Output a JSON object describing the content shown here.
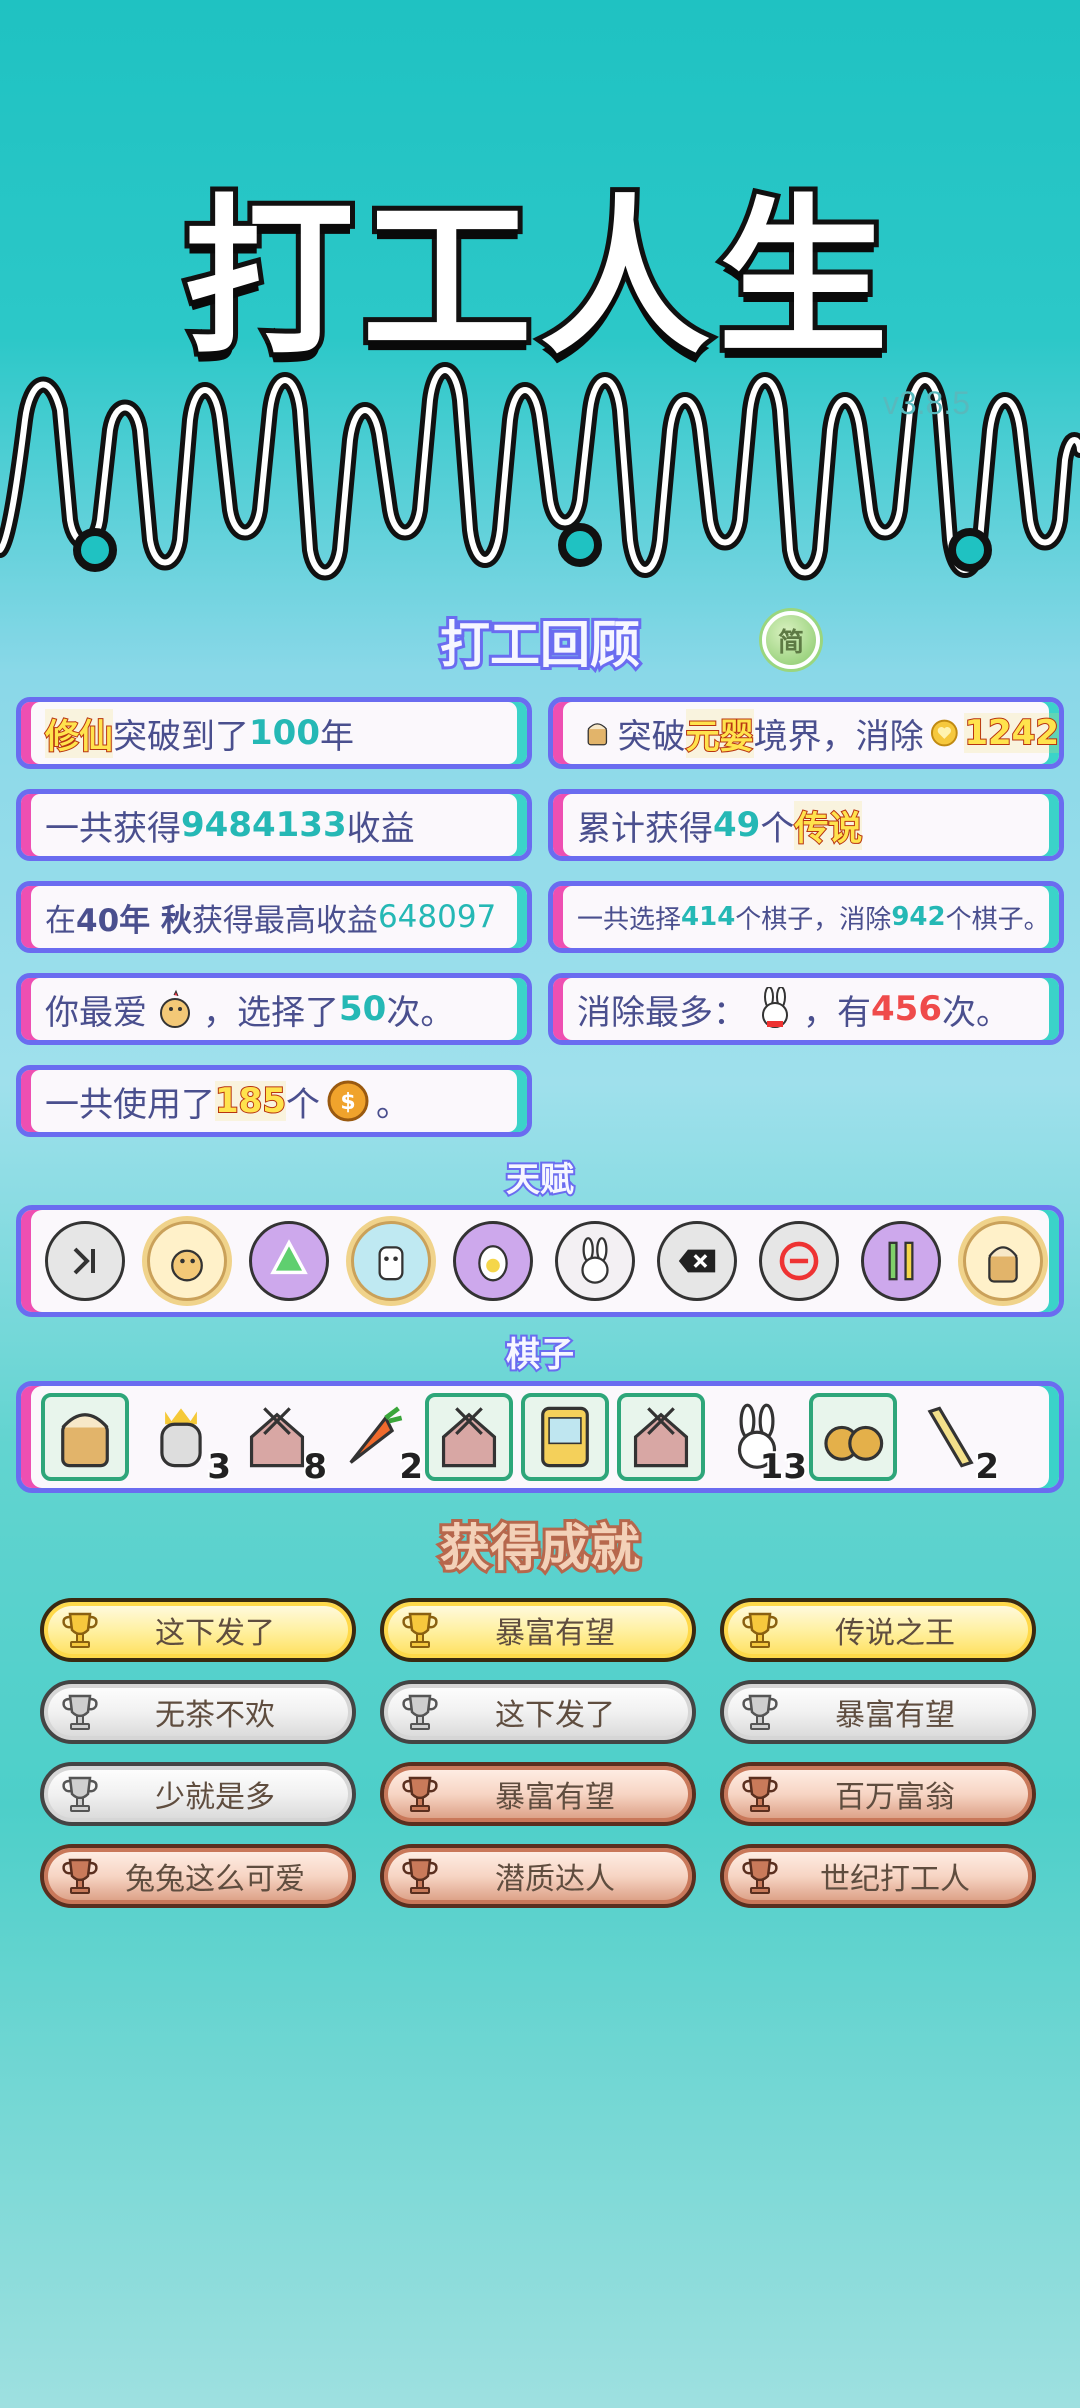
{
  "app": {
    "title": "打工人生",
    "version": "v3.8.5"
  },
  "review": {
    "title": "打工回顾",
    "lang_badge": "简",
    "cards": {
      "c1": {
        "a": "修仙",
        "b": "突破到了",
        "c": "100",
        "d": "年"
      },
      "c2": {
        "a": "突破",
        "b": "元婴",
        "c": "境界，消除",
        "d": "1242"
      },
      "c3": {
        "a": "一共获得",
        "b": "9484133",
        "c": "收益"
      },
      "c4": {
        "a": "累计获得",
        "b": "49",
        "c": "个",
        "d": "传说"
      },
      "c5": {
        "a": "在 ",
        "b": "40年 秋",
        "c": " 获得最高收益",
        "d": "648097"
      },
      "c6": {
        "a": "一共选择",
        "b": "414",
        "c": "个棋子，消除",
        "d": "942",
        "e": "个棋子。"
      },
      "c7": {
        "a": "你最爱",
        "b": "，选择了",
        "c": "50",
        "d": "次。"
      },
      "c8": {
        "a": "消除最多：",
        "b": "，有",
        "c": "456",
        "d": "次。"
      },
      "c9": {
        "a": "一共使用了",
        "b": "185",
        "c": "个",
        "d": "。"
      }
    }
  },
  "talents": {
    "title": "天赋",
    "icons": [
      "skip-icon",
      "chick-icon",
      "recycle-icon",
      "husky-icon",
      "egg-icon",
      "rabbit-icon",
      "delete-tag-icon",
      "minus-icon",
      "bamboo-icon",
      "milk-tea-icon"
    ]
  },
  "pieces": {
    "title": "棋子",
    "items": [
      {
        "icon": "milk-tea-icon",
        "count": ""
      },
      {
        "icon": "crowned-husky-icon",
        "count": "3"
      },
      {
        "icon": "rabbit-house-icon",
        "count": "8"
      },
      {
        "icon": "carrot-icon",
        "count": "2"
      },
      {
        "icon": "rabbit-house-icon",
        "count": ""
      },
      {
        "icon": "claw-machine-icon",
        "count": ""
      },
      {
        "icon": "rabbit-house-icon",
        "count": ""
      },
      {
        "icon": "rabbit-icon",
        "count": "13"
      },
      {
        "icon": "sesame-balls-icon",
        "count": ""
      },
      {
        "icon": "pencil-icon",
        "count": "2"
      }
    ]
  },
  "achievements": {
    "title": "获得成就",
    "items": [
      {
        "label": "这下发了",
        "tier": "gold"
      },
      {
        "label": "暴富有望",
        "tier": "gold"
      },
      {
        "label": "传说之王",
        "tier": "gold"
      },
      {
        "label": "无茶不欢",
        "tier": "silver"
      },
      {
        "label": "这下发了",
        "tier": "silver"
      },
      {
        "label": "暴富有望",
        "tier": "silver"
      },
      {
        "label": "少就是多",
        "tier": "silver"
      },
      {
        "label": "暴富有望",
        "tier": "bronze"
      },
      {
        "label": "百万富翁",
        "tier": "bronze"
      },
      {
        "label": "兔兔这么可爱",
        "tier": "bronze"
      },
      {
        "label": "潜质达人",
        "tier": "bronze"
      },
      {
        "label": "世纪打工人",
        "tier": "bronze"
      }
    ]
  },
  "colors": {
    "accent_blue": "#6a6cf0",
    "accent_pink": "#ee4fb2",
    "accent_teal": "#3bd3c9",
    "gold": "#ffe34d",
    "silver": "#d8d8d8",
    "bronze": "#d99a7f"
  }
}
